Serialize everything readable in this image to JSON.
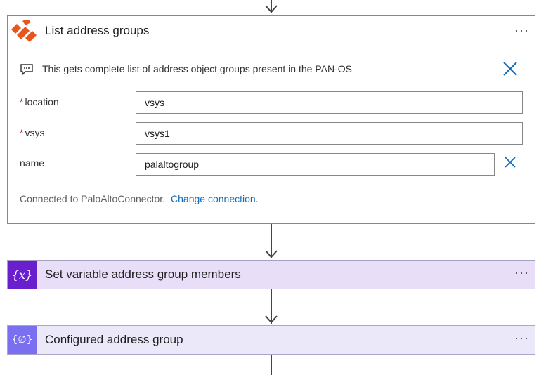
{
  "action": {
    "title": "List address groups",
    "description": "This gets complete list of address object groups present in the PAN-OS",
    "fields": [
      {
        "label": "location",
        "required": true,
        "value": "vsys"
      },
      {
        "label": "vsys",
        "required": true,
        "value": "vsys1"
      },
      {
        "label": "name",
        "required": false,
        "value": "palaltogroup"
      }
    ],
    "required_marker": "*",
    "connection_text": "Connected to PaloAltoConnector.",
    "connection_link": "Change connection."
  },
  "steps": [
    {
      "title": "Set variable address group members",
      "icon": "variable-icon",
      "icon_text": "{x}",
      "color": "#6a1fcf"
    },
    {
      "title": "Configured address group",
      "icon": "compose-icon",
      "icon_text": "{∅}",
      "color": "#7a6ff0"
    }
  ],
  "more_glyph": "···",
  "colors": {
    "paloalto_orange": "#e8561c",
    "close_blue": "#0f6cbd",
    "required_red": "#a4262c"
  }
}
